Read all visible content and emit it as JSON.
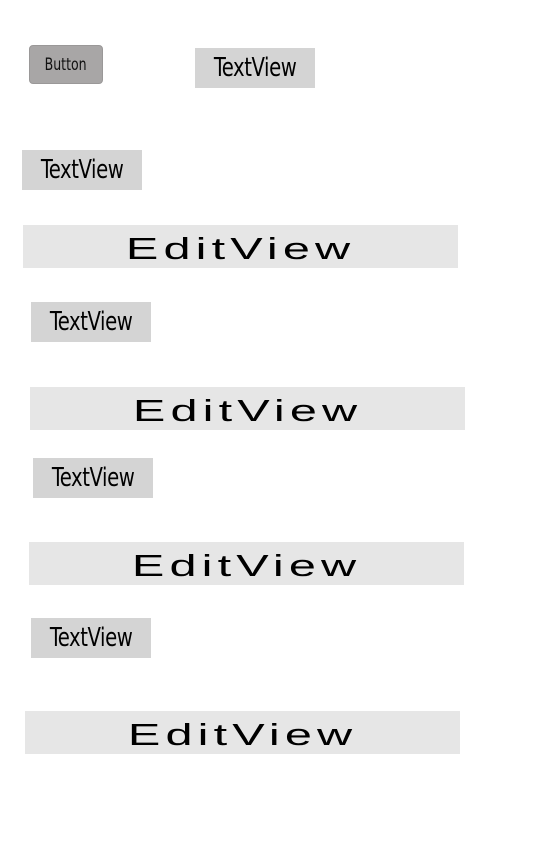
{
  "button": {
    "label": "Button"
  },
  "textviews": [
    "TextView",
    "TextView",
    "TextView",
    "TextView",
    "TextView"
  ],
  "editviews": [
    "EditView",
    "EditView",
    "EditView",
    "EditView"
  ]
}
